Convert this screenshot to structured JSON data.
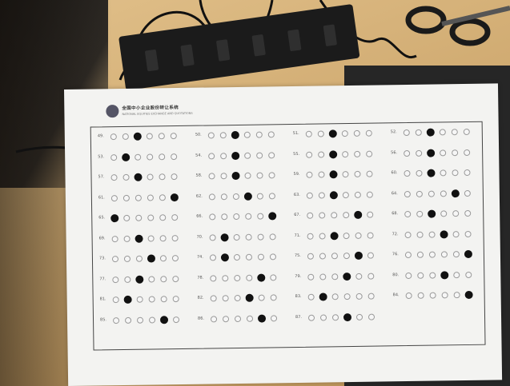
{
  "scene": {
    "description_colors": {
      "desk": "#d2ad74",
      "paper": "#f3f3f1",
      "mark": "#111111"
    }
  },
  "sheet": {
    "title": "全国中小企业股份转让系统",
    "subtitle": "NATIONAL EQUITIES EXCHANGE AND QUOTATIONS",
    "options_per_question": 6,
    "questions": [
      {
        "n": "49.",
        "mark": 2
      },
      {
        "n": "50.",
        "mark": 2
      },
      {
        "n": "51.",
        "mark": 2
      },
      {
        "n": "52.",
        "mark": 2
      },
      {
        "n": "53.",
        "mark": 1
      },
      {
        "n": "54.",
        "mark": 2
      },
      {
        "n": "55.",
        "mark": 2
      },
      {
        "n": "56.",
        "mark": 2
      },
      {
        "n": "57.",
        "mark": 2
      },
      {
        "n": "58.",
        "mark": 2
      },
      {
        "n": "59.",
        "mark": 2
      },
      {
        "n": "60.",
        "mark": 2
      },
      {
        "n": "61.",
        "mark": 5
      },
      {
        "n": "62.",
        "mark": 3
      },
      {
        "n": "63.",
        "mark": 2
      },
      {
        "n": "64.",
        "mark": 4
      },
      {
        "n": "65.",
        "mark": 0
      },
      {
        "n": "66.",
        "mark": 5
      },
      {
        "n": "67.",
        "mark": 4
      },
      {
        "n": "68.",
        "mark": 2
      },
      {
        "n": "69.",
        "mark": 2
      },
      {
        "n": "70.",
        "mark": 1
      },
      {
        "n": "71.",
        "mark": 2
      },
      {
        "n": "72.",
        "mark": 3
      },
      {
        "n": "73.",
        "mark": 3
      },
      {
        "n": "74.",
        "mark": 1
      },
      {
        "n": "75.",
        "mark": 4
      },
      {
        "n": "76.",
        "mark": 5
      },
      {
        "n": "77.",
        "mark": 2
      },
      {
        "n": "78.",
        "mark": 4
      },
      {
        "n": "79.",
        "mark": 3
      },
      {
        "n": "80.",
        "mark": 3
      },
      {
        "n": "81.",
        "mark": 1
      },
      {
        "n": "82.",
        "mark": 3
      },
      {
        "n": "83.",
        "mark": 1
      },
      {
        "n": "84.",
        "mark": 5
      },
      {
        "n": "85.",
        "mark": 4
      },
      {
        "n": "86.",
        "mark": 4
      },
      {
        "n": "87.",
        "mark": 3
      }
    ]
  }
}
